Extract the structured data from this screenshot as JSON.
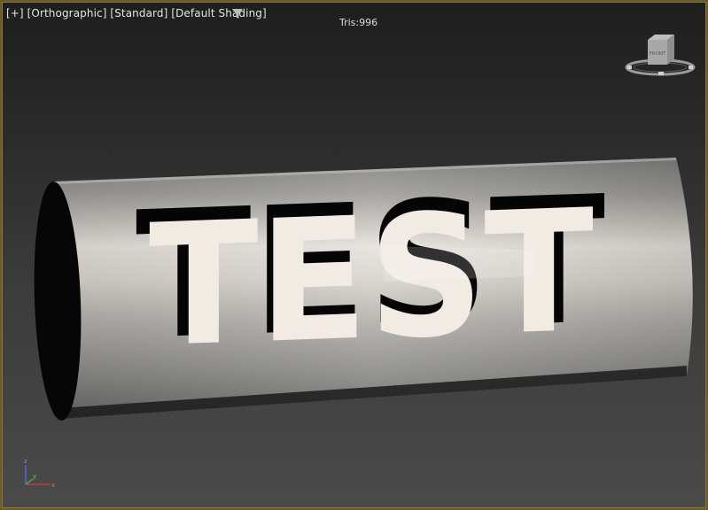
{
  "viewport": {
    "labels": {
      "plus": "[+]",
      "view": "[Orthographic]",
      "standard": "[Standard]",
      "shading": "[Default Shading]"
    },
    "stats": "Tris:996",
    "model_text": "TEST",
    "viewcube_face": "FRONT",
    "filter_icon": "filter-funnel-icon",
    "axis": {
      "x": "x",
      "y": "y",
      "z": "z"
    }
  },
  "colors": {
    "frame": "#8d7a3a",
    "label_text": "#e6e6e6",
    "letters": "#f1ebe4",
    "cut": "#050505"
  }
}
